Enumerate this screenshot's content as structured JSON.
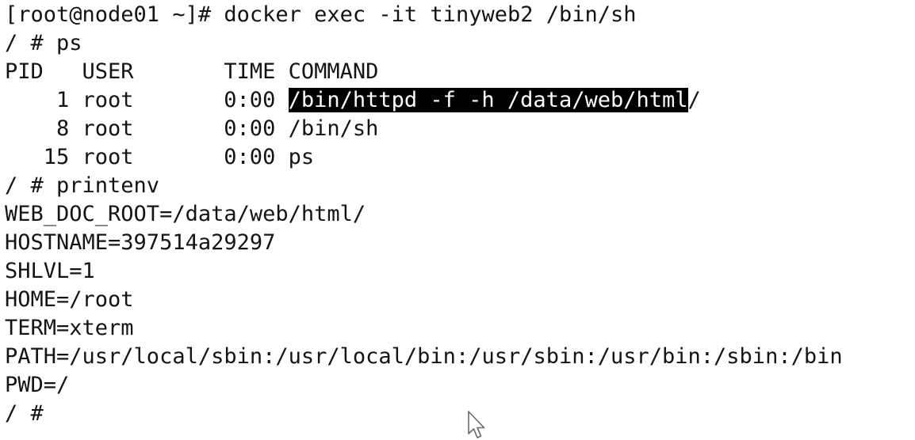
{
  "terminal": {
    "prompt_line": "[root@node01 ~]# docker exec -it tinyweb2 /bin/sh",
    "ps_command": "/ # ps",
    "ps_header": {
      "pid": "PID",
      "user": "USER",
      "time": "TIME",
      "command": "COMMAND"
    },
    "ps_rows": [
      {
        "pid": "1",
        "user": "root",
        "time": "0:00",
        "command_selected": "/bin/httpd -f -h /data/web/html",
        "command_rest": "/"
      },
      {
        "pid": "8",
        "user": "root",
        "time": "0:00",
        "command_selected": "",
        "command_rest": "/bin/sh"
      },
      {
        "pid": "15",
        "user": "root",
        "time": "0:00",
        "command_selected": "",
        "command_rest": "ps"
      }
    ],
    "printenv_command": "/ # printenv",
    "env_lines": [
      "WEB_DOC_ROOT=/data/web/html/",
      "HOSTNAME=397514a29297",
      "SHLVL=1",
      "HOME=/root",
      "TERM=xterm",
      "PATH=/usr/local/sbin:/usr/local/bin:/usr/sbin:/usr/bin:/sbin:/bin",
      "PWD=/"
    ],
    "final_prompt": "/ # "
  },
  "colors": {
    "background": "#ffffff",
    "text": "#141414",
    "selection_bg": "#000000",
    "selection_fg": "#ffffff"
  },
  "icons": {
    "mouse_cursor": "arrow-pointer-icon"
  }
}
